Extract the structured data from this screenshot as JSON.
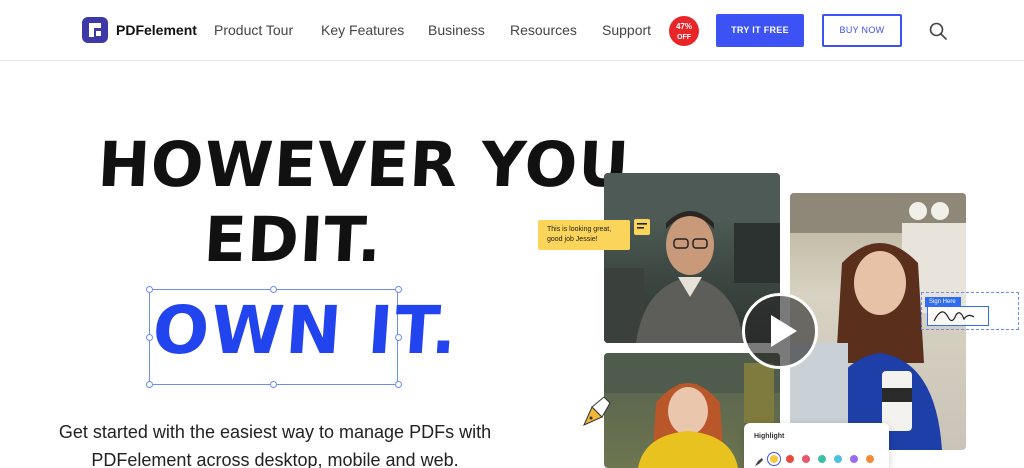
{
  "nav": {
    "logo_text": "PDFelement",
    "links": [
      "Product Tour",
      "Key Features",
      "Business",
      "Resources",
      "Support"
    ],
    "badge_pct": "47%",
    "badge_off": "OFF",
    "try_label": "TRY IT FREE",
    "buy_label": "BUY NOW"
  },
  "hero": {
    "line1": "HOWEVER YOU",
    "line2": "EDIT.",
    "line3": "OWN IT.",
    "subtitle": "Get started with the easiest way to manage PDFs with PDFelement across desktop, mobile and web."
  },
  "media": {
    "comment": [
      "This is looking great,",
      "good job Jessie!"
    ],
    "sign_label": "Sign Here",
    "highlight_title": "Highlight",
    "highlight_colors": [
      "#f5c93a",
      "#e84b3c",
      "#e8576b",
      "#3cc0a8",
      "#4cc1e0",
      "#9a6cf0",
      "#f28b3a"
    ]
  },
  "colors": {
    "brand": "#3d52f5",
    "accent_blue": "#2244ee",
    "badge_red": "#e8262a",
    "comment_yellow": "#fbd55a"
  }
}
